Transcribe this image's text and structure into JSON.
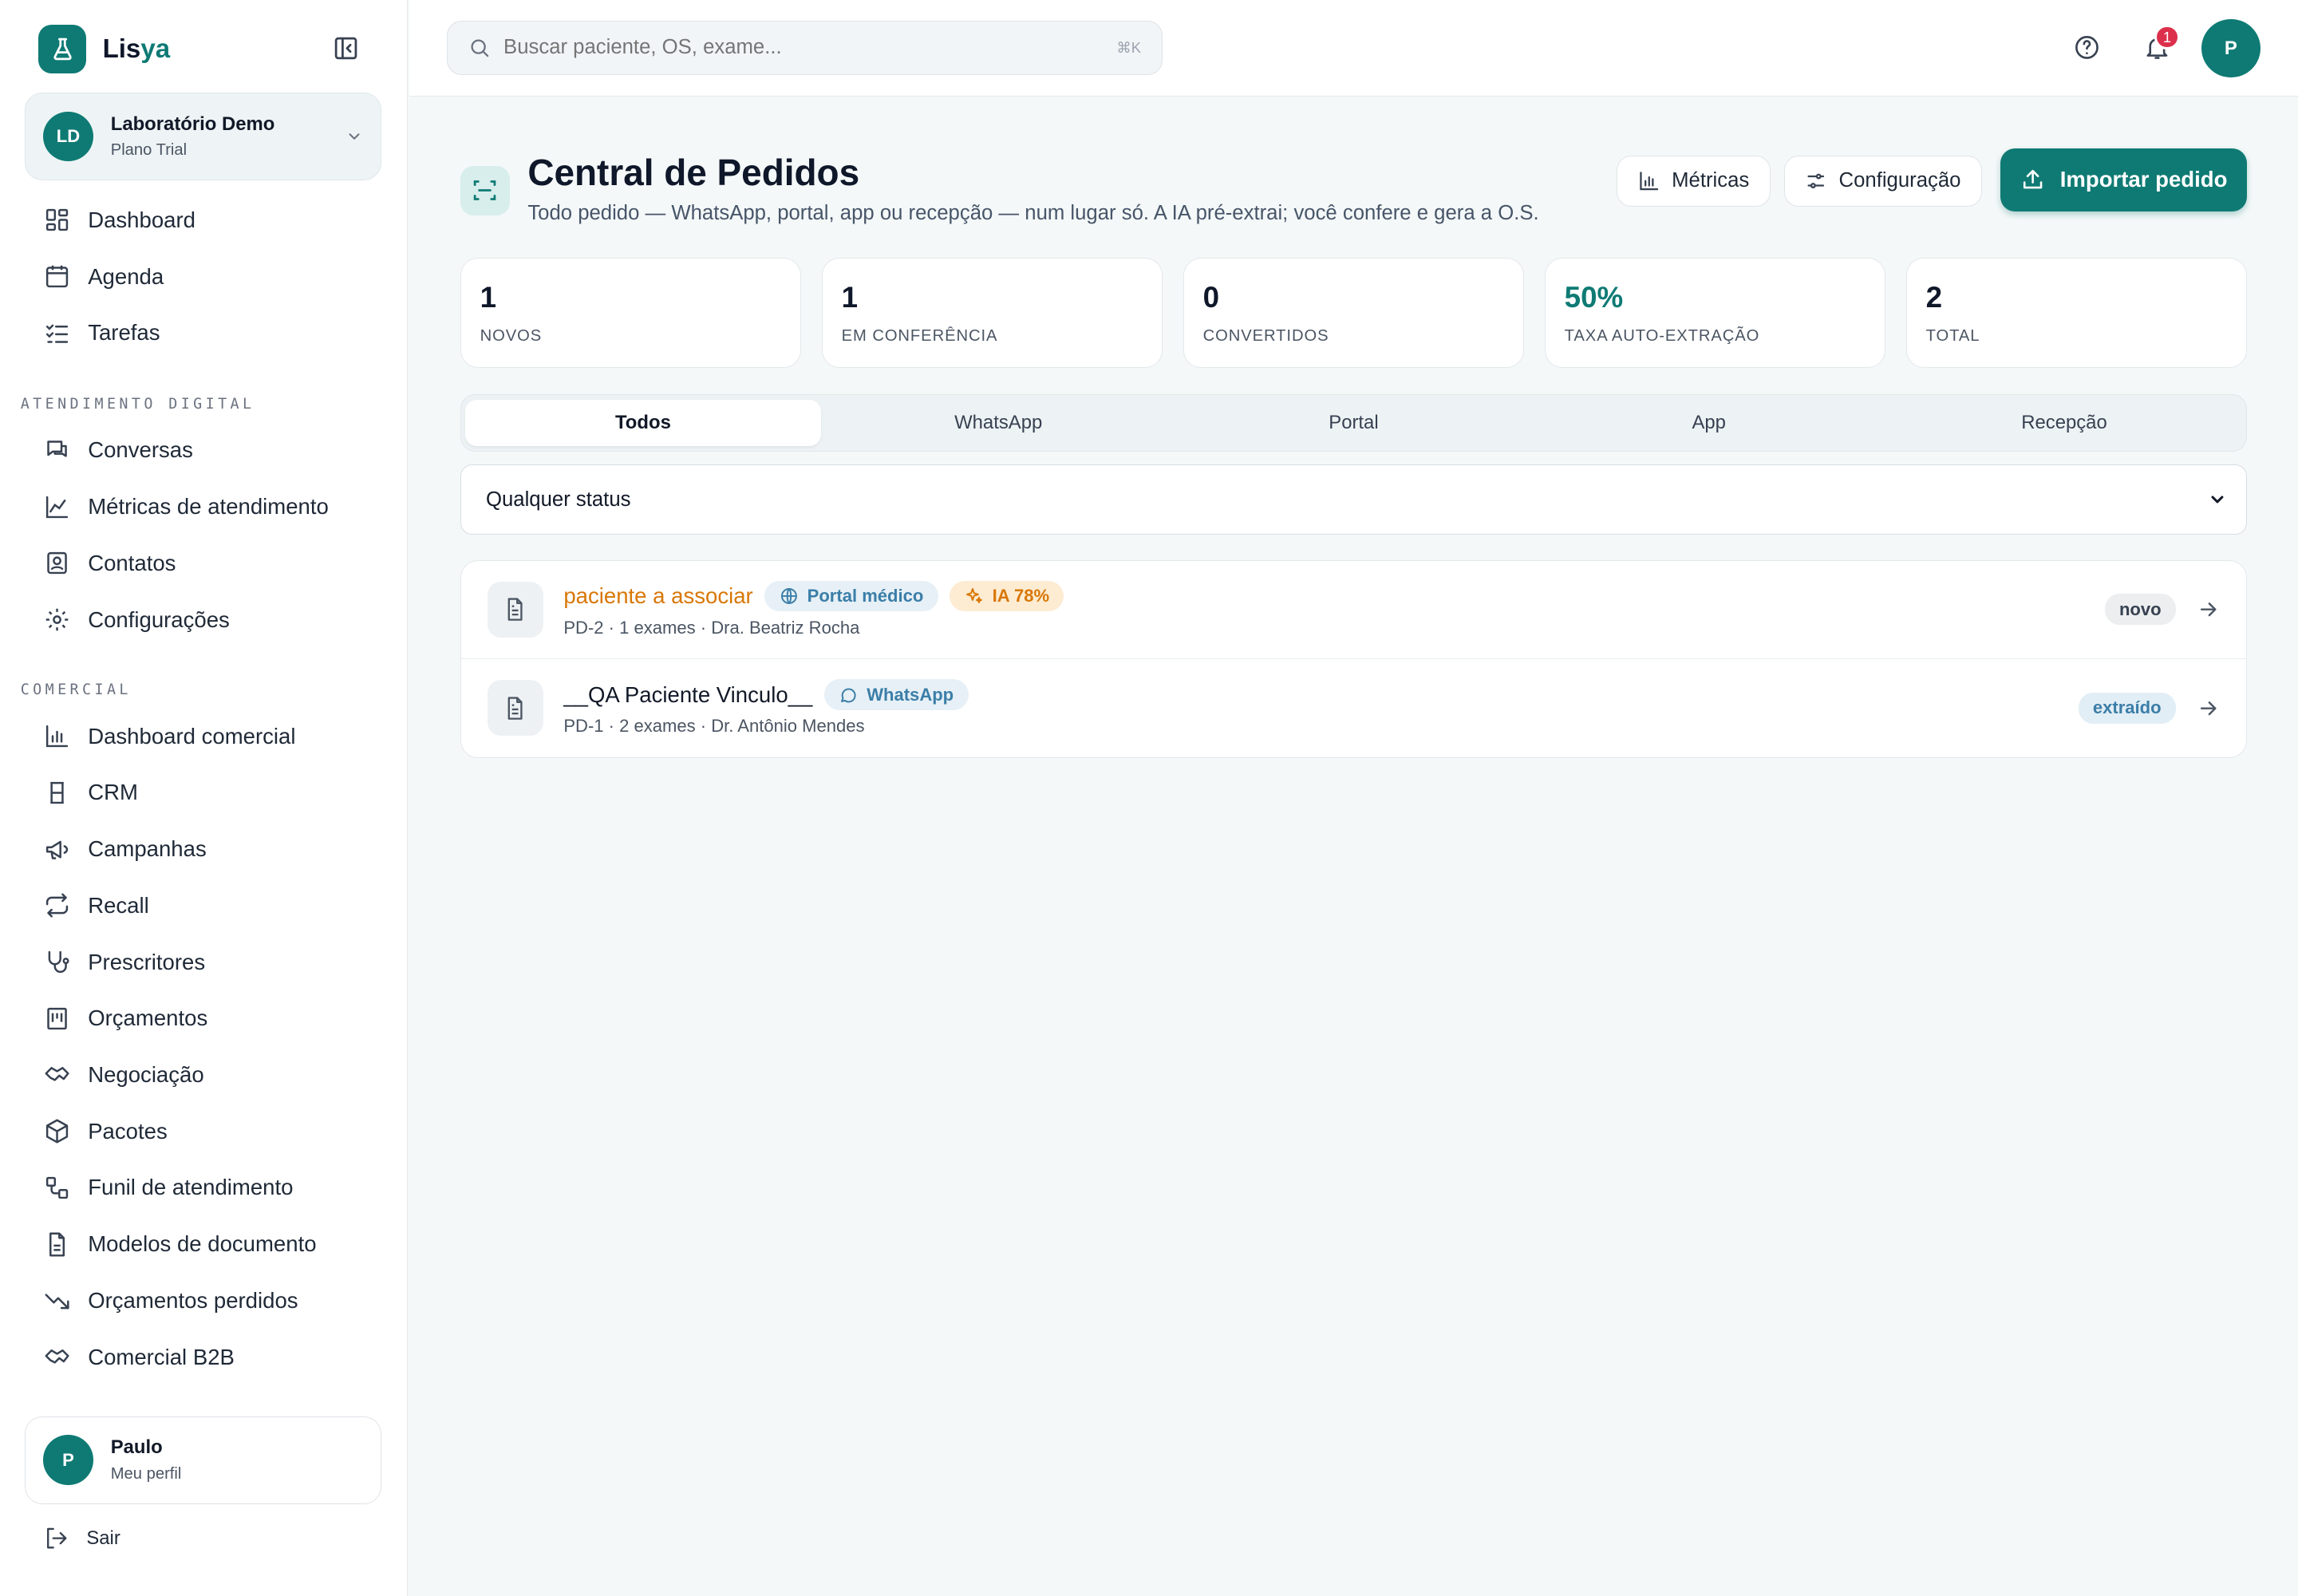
{
  "brand": {
    "name_a": "Lis",
    "name_b": "ya"
  },
  "org": {
    "initials": "LD",
    "name": "Laboratório Demo",
    "plan": "Plano Trial"
  },
  "nav_main": [
    {
      "label": "Dashboard",
      "icon": "dashboard-icon"
    },
    {
      "label": "Agenda",
      "icon": "calendar-icon"
    },
    {
      "label": "Tarefas",
      "icon": "tasks-icon"
    }
  ],
  "section_digital": "ATENDIMENTO DIGITAL",
  "nav_digital": [
    {
      "label": "Conversas",
      "icon": "chat-icon"
    },
    {
      "label": "Métricas de atendimento",
      "icon": "line-chart-icon"
    },
    {
      "label": "Contatos",
      "icon": "contacts-icon"
    },
    {
      "label": "Configurações",
      "icon": "gear-icon"
    }
  ],
  "section_comercial": "COMERCIAL",
  "nav_comercial": [
    {
      "label": "Dashboard comercial",
      "icon": "bar-chart-icon"
    },
    {
      "label": "CRM",
      "icon": "crm-icon"
    },
    {
      "label": "Campanhas",
      "icon": "megaphone-icon"
    },
    {
      "label": "Recall",
      "icon": "repeat-icon"
    },
    {
      "label": "Prescritores",
      "icon": "stethoscope-icon"
    },
    {
      "label": "Orçamentos",
      "icon": "receipt-icon"
    },
    {
      "label": "Negociação",
      "icon": "handshake-icon"
    },
    {
      "label": "Pacotes",
      "icon": "package-icon"
    },
    {
      "label": "Funil de atendimento",
      "icon": "funnel-icon"
    },
    {
      "label": "Modelos de documento",
      "icon": "document-icon"
    },
    {
      "label": "Orçamentos perdidos",
      "icon": "trending-down-icon"
    },
    {
      "label": "Comercial B2B",
      "icon": "handshake-icon"
    }
  ],
  "profile": {
    "initial": "P",
    "name": "Paulo",
    "sub": "Meu perfil"
  },
  "logout": "Sair",
  "search": {
    "placeholder": "Buscar paciente, OS, exame...",
    "shortcut": "⌘K"
  },
  "notifications": {
    "count": "1"
  },
  "user_initial": "P",
  "page": {
    "title": "Central de Pedidos",
    "subtitle": "Todo pedido — WhatsApp, portal, app ou recepção — num lugar só. A IA pré-extrai; você confere e gera a O.S."
  },
  "actions": {
    "metrics": "Métricas",
    "config": "Configuração",
    "import": "Importar pedido"
  },
  "stats": [
    {
      "value": "1",
      "label": "NOVOS"
    },
    {
      "value": "1",
      "label": "EM CONFERÊNCIA"
    },
    {
      "value": "0",
      "label": "CONVERTIDOS"
    },
    {
      "value": "50%",
      "label": "TAXA AUTO-EXTRAÇÃO"
    },
    {
      "value": "2",
      "label": "TOTAL"
    }
  ],
  "tabs": [
    "Todos",
    "WhatsApp",
    "Portal",
    "App",
    "Recepção"
  ],
  "status_filter": "Qualquer status",
  "orders": [
    {
      "patient": "paciente a associar",
      "source": "Portal médico",
      "ai": "IA 78%",
      "meta": "PD-2 · 1 exames · Dra. Beatriz Rocha",
      "status": "novo"
    },
    {
      "patient": "__QA Paciente Vinculo__",
      "source": "WhatsApp",
      "meta": "PD-1 · 2 exames · Dr. Antônio Mendes",
      "status": "extraído"
    }
  ],
  "colors": {
    "accent": "#0f7a74",
    "warn": "#d97706",
    "badge": "#dc2f4b",
    "chip_blue": "#3b7ea8"
  }
}
